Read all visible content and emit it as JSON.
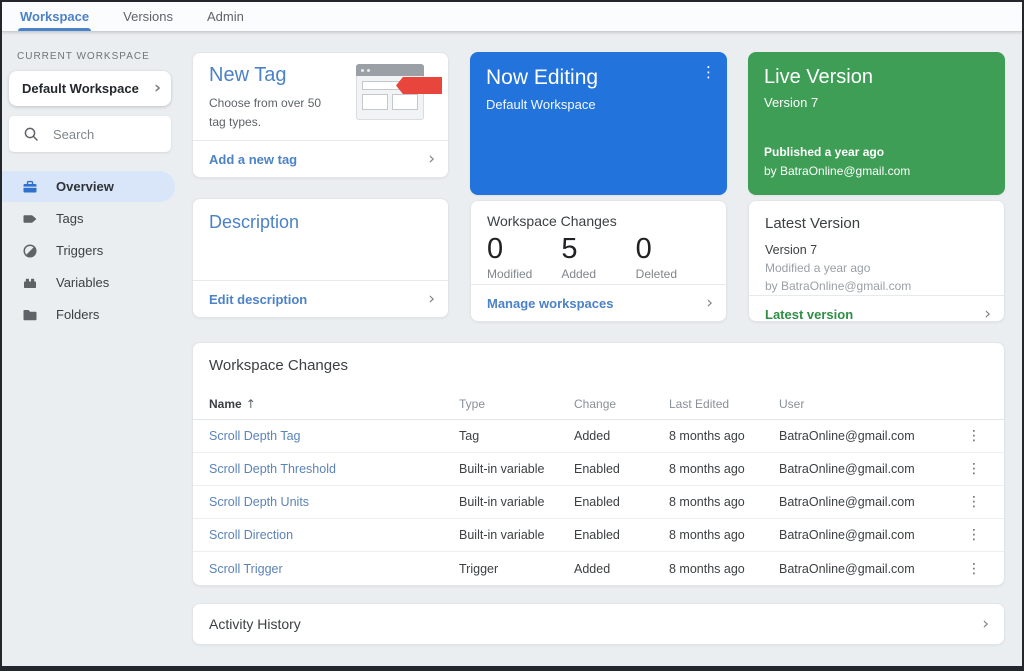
{
  "top_nav": {
    "tabs": [
      {
        "label": "Workspace",
        "active": true
      },
      {
        "label": "Versions",
        "active": false
      },
      {
        "label": "Admin",
        "active": false
      }
    ]
  },
  "sidebar": {
    "section_label": "CURRENT WORKSPACE",
    "workspace_selector": "Default Workspace",
    "search_placeholder": "Search",
    "items": [
      {
        "label": "Overview",
        "icon": "overview-icon",
        "active": true
      },
      {
        "label": "Tags",
        "icon": "tag-icon",
        "active": false
      },
      {
        "label": "Triggers",
        "icon": "trigger-icon",
        "active": false
      },
      {
        "label": "Variables",
        "icon": "variables-icon",
        "active": false
      },
      {
        "label": "Folders",
        "icon": "folder-icon",
        "active": false
      }
    ]
  },
  "cards": {
    "new_tag": {
      "title": "New Tag",
      "description": "Choose from over 50 tag types.",
      "link": "Add a new tag"
    },
    "description": {
      "title": "Description",
      "link": "Edit description"
    },
    "now_editing": {
      "title": "Now Editing",
      "subtitle": "Default Workspace"
    },
    "workspace_changes": {
      "title": "Workspace Changes",
      "stats": [
        {
          "value": "0",
          "label": "Modified"
        },
        {
          "value": "5",
          "label": "Added"
        },
        {
          "value": "0",
          "label": "Deleted"
        }
      ],
      "link": "Manage workspaces"
    },
    "live_version": {
      "title": "Live Version",
      "version": "Version 7",
      "published": "Published a year ago",
      "author": "by BatraOnline@gmail.com"
    },
    "latest_version": {
      "title": "Latest Version",
      "version": "Version 7",
      "modified": "Modified a year ago",
      "author": "by BatraOnline@gmail.com",
      "link": "Latest version"
    }
  },
  "table": {
    "title": "Workspace Changes",
    "columns": {
      "name": "Name",
      "type": "Type",
      "change": "Change",
      "last_edited": "Last Edited",
      "user": "User"
    },
    "sort_indicator": "↑",
    "rows": [
      {
        "name": "Scroll Depth Tag",
        "type": "Tag",
        "change": "Added",
        "last_edited": "8 months ago",
        "user": "BatraOnline@gmail.com"
      },
      {
        "name": "Scroll Depth Threshold",
        "type": "Built-in variable",
        "change": "Enabled",
        "last_edited": "8 months ago",
        "user": "BatraOnline@gmail.com"
      },
      {
        "name": "Scroll Depth Units",
        "type": "Built-in variable",
        "change": "Enabled",
        "last_edited": "8 months ago",
        "user": "BatraOnline@gmail.com"
      },
      {
        "name": "Scroll Direction",
        "type": "Built-in variable",
        "change": "Enabled",
        "last_edited": "8 months ago",
        "user": "BatraOnline@gmail.com"
      },
      {
        "name": "Scroll Trigger",
        "type": "Trigger",
        "change": "Added",
        "last_edited": "8 months ago",
        "user": "BatraOnline@gmail.com"
      }
    ]
  },
  "activity": {
    "title": "Activity History"
  },
  "colors": {
    "accent_blue": "#2273dc",
    "accent_green": "#3e9e55",
    "link_blue": "#4c82c6",
    "link_green": "#2f8f47",
    "table_link_blue": "#5b83b8",
    "active_pill": "#d9e6f9",
    "tag_red": "#e8453c"
  },
  "glyphs": {
    "chevron_right": "›",
    "kebab": "⋮"
  }
}
